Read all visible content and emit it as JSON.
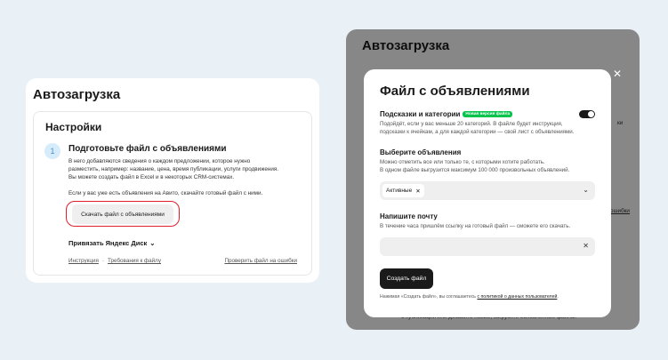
{
  "left": {
    "title": "Автозагрузка",
    "settings_title": "Настройки",
    "step_number": "1",
    "step_title": "Подготовьте файл с объявлениями",
    "step_desc_1": "В него добавляются сведения о каждом предложении, которое нужно",
    "step_desc_2": "разместить, например: название, цена, время публикации, услуги продвижения.",
    "step_desc_3": "Вы можете создать файл в Excel и в некоторых CRM-системах.",
    "step_note": "Если у вас уже есть объявления на Авито, скачайте готовый файл с ними.",
    "download_label": "Скачать файл с объявлениями",
    "yadisk_label": "Привязать Яндекс Диск",
    "link_instruction": "Инструкция",
    "link_sep": "·",
    "link_requirements": "Требования к файлу",
    "link_check": "Проверить файл на ошибки"
  },
  "right_bg": {
    "title": "Автозагрузка",
    "frag_1": "ки",
    "frag_2": "ошибки",
    "frag_3": "с публикаций или добавить новые, загрузите обновленные файлы."
  },
  "modal": {
    "title": "Файл с объявлениями",
    "hints_title": "Подсказки и категории",
    "hints_badge": "Новая версия файла",
    "hints_desc_1": "Подойдёт, если у вас меньше 20 категорий. В файле будет инструкция,",
    "hints_desc_2": "подсказки к ячейкам, а для каждой категории — свой лист с объявлениями.",
    "ads_title": "Выберите объявления",
    "ads_desc_1": "Можно отметить все или только те, с которыми хотите работать.",
    "ads_desc_2": "В одном файле выгрузится максимум 100 000 произвольных объявлений.",
    "ads_chip": "Активные",
    "email_title": "Напишите почту",
    "email_desc": "В течение часа пришлём ссылку на готовый файл — сможете его скачать.",
    "email_value": "",
    "create_label": "Создать файл",
    "agree_text": "Нажимая «Создать файл», вы соглашаетесь ",
    "agree_link": "с политикой о данных пользователей",
    "agree_end": "."
  },
  "colors": {
    "accent_green": "#04c44c",
    "highlight_red": "#e01e2b",
    "step_blue": "#d6ecfb"
  },
  "icons": [
    "chevron-down-icon",
    "close-icon",
    "toggle-on"
  ]
}
